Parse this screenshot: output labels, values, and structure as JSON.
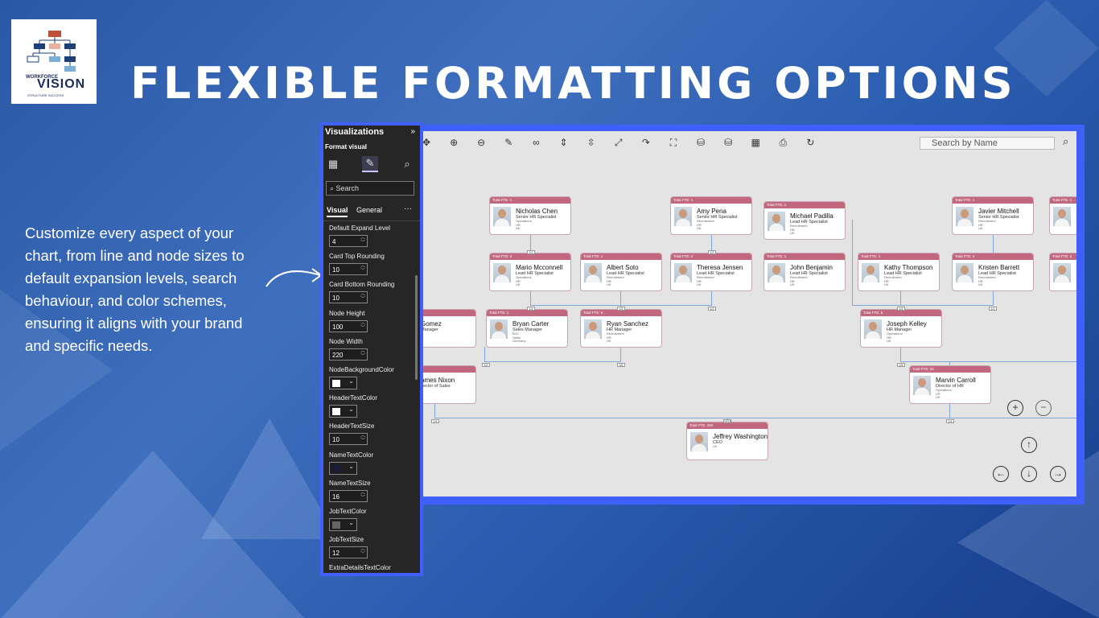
{
  "logo": {
    "small": "WORKFORCE",
    "big": "VISION",
    "tagline": "STRUCTURE SUCCESS"
  },
  "title": "FLEXIBLE FORMATTING OPTIONS",
  "description": "Customize every aspect of your chart, from line and node sizes to default expansion levels, search behaviour, and color schemes, ensuring it aligns with your brand and specific needs.",
  "pbi": {
    "header": "Visualizations",
    "collapse": "»",
    "subheader": "Format visual",
    "search_placeholder": "Search",
    "tabs": [
      "Visual",
      "General"
    ],
    "more": "···",
    "settings": [
      {
        "label": "Default Expand Level",
        "type": "number",
        "value": "4"
      },
      {
        "label": "Card Top Rounding",
        "type": "number",
        "value": "10"
      },
      {
        "label": "Card Bottom Rounding",
        "type": "number",
        "value": "10"
      },
      {
        "label": "Node Height",
        "type": "number",
        "value": "100"
      },
      {
        "label": "Node Width",
        "type": "number",
        "value": "220"
      },
      {
        "label": "NodeBackgroundColor",
        "type": "color",
        "color": "#ffffff"
      },
      {
        "label": "HeaderTextColor",
        "type": "color",
        "color": "#ffffff"
      },
      {
        "label": "HeaderTextSize",
        "type": "number",
        "value": "10"
      },
      {
        "label": "NameTextColor",
        "type": "color",
        "color": "#1a1a3a"
      },
      {
        "label": "NameTextSize",
        "type": "number",
        "value": "16"
      },
      {
        "label": "JobTextColor",
        "type": "color",
        "color": "#666666"
      },
      {
        "label": "JobTextSize",
        "type": "number",
        "value": "12"
      },
      {
        "label": "ExtraDetailsTextColor",
        "type": "label"
      }
    ]
  },
  "chart": {
    "search_placeholder": "Search by Name",
    "toolbar_icons": [
      "move-icon",
      "zoom-in-icon",
      "zoom-out-icon",
      "pen-icon",
      "link-icon",
      "expand-vertical-icon",
      "compress-vertical-icon",
      "fit-screen-icon",
      "redo-icon",
      "fullscreen-icon",
      "database-icon",
      "database-alt-icon",
      "table-icon",
      "print-icon",
      "refresh-icon"
    ],
    "nodes": [
      {
        "hdr": "Total FTE: 1",
        "name": "Nicholas Chen",
        "job": "Senior HR Specialist",
        "extra": [
          "Operations",
          "HR",
          "UK"
        ]
      },
      {
        "hdr": "Total FTE: 1",
        "name": "Amy Pena",
        "job": "Senior HR Specialist",
        "extra": [
          "Recruitment",
          "HR",
          "UK"
        ]
      },
      {
        "hdr": "Total FTE: 1",
        "name": "Michael Padilla",
        "job": "Lead HR Specialist",
        "extra": [
          "Recruitment",
          "HR",
          "UK"
        ]
      },
      {
        "hdr": "Total FTE: 1",
        "name": "Javier Mitchell",
        "job": "Senior HR Specialist",
        "extra": [
          "Recruitment",
          "HR",
          "UK"
        ]
      },
      {
        "hdr": "Total FTE: 1",
        "name": "",
        "job": "",
        "extra": []
      },
      {
        "hdr": "Total FTE: 2",
        "name": "Mario Mcconnell",
        "job": "Lead HR Specialist",
        "extra": [
          "Operations",
          "HR",
          "UK"
        ]
      },
      {
        "hdr": "Total FTE: 1",
        "name": "Albert Soto",
        "job": "Lead HR Specialist",
        "extra": [
          "Recruitment",
          "HR",
          "UK"
        ]
      },
      {
        "hdr": "Total FTE: 2",
        "name": "Theresa Jensen",
        "job": "Lead HR Specialist",
        "extra": [
          "Recruitment",
          "HR",
          "UK"
        ]
      },
      {
        "hdr": "Total FTE: 1",
        "name": "John Benjamin",
        "job": "Lead HR Specialist",
        "extra": [
          "Recruitment",
          "HR",
          "UK"
        ]
      },
      {
        "hdr": "Total FTE: 1",
        "name": "Kathy Thompson",
        "job": "Lead HR Specialist",
        "extra": [
          "Recruitment",
          "HR",
          "UK"
        ]
      },
      {
        "hdr": "Total FTE: 2",
        "name": "Kristen Barrett",
        "job": "Lead HR Specialist",
        "extra": [
          "Recruitment",
          "HR",
          "UK"
        ]
      },
      {
        "hdr": "Total FTE: 2",
        "name": "",
        "job": "",
        "extra": []
      },
      {
        "hdr": "",
        "name": "Gomez",
        "job": "Manager",
        "extra": []
      },
      {
        "hdr": "Total FTE: 1",
        "name": "Bryan Carter",
        "job": "Sales Manager",
        "extra": [
          "B2C",
          "Sales",
          "Germany"
        ]
      },
      {
        "hdr": "Total FTE: 6",
        "name": "Ryan Sanchez",
        "job": "HR Manager",
        "extra": [
          "Recruitment",
          "HR",
          "UK"
        ]
      },
      {
        "hdr": "Total FTE: 6",
        "name": "Joseph Kelley",
        "job": "HR Manager",
        "extra": [
          "Operations",
          "HR",
          "UK"
        ]
      },
      {
        "hdr": "",
        "name": "ames Nixon",
        "job": "irector of Sales",
        "extra": []
      },
      {
        "hdr": "Total FTE: 22",
        "name": "Marvin Carroll",
        "job": "Director of HR",
        "extra": [
          "Operations",
          "HR",
          "UK"
        ]
      },
      {
        "hdr": "Total FTE: 260",
        "name": "Jeffrey Washington",
        "job": "CEO",
        "extra": [
          "UK"
        ]
      }
    ],
    "badges": [
      "1/1",
      "1/1",
      "1/1",
      "1/2",
      "1/2",
      "1/1",
      "1/2",
      "1/2",
      "1/6",
      "1/6",
      "1/4",
      "1/4",
      "1/4",
      "15/15"
    ],
    "nav": {
      "zoom_in": "+",
      "zoom_out": "−",
      "up": "↑",
      "left": "←",
      "down": "↓",
      "right": "→"
    }
  }
}
